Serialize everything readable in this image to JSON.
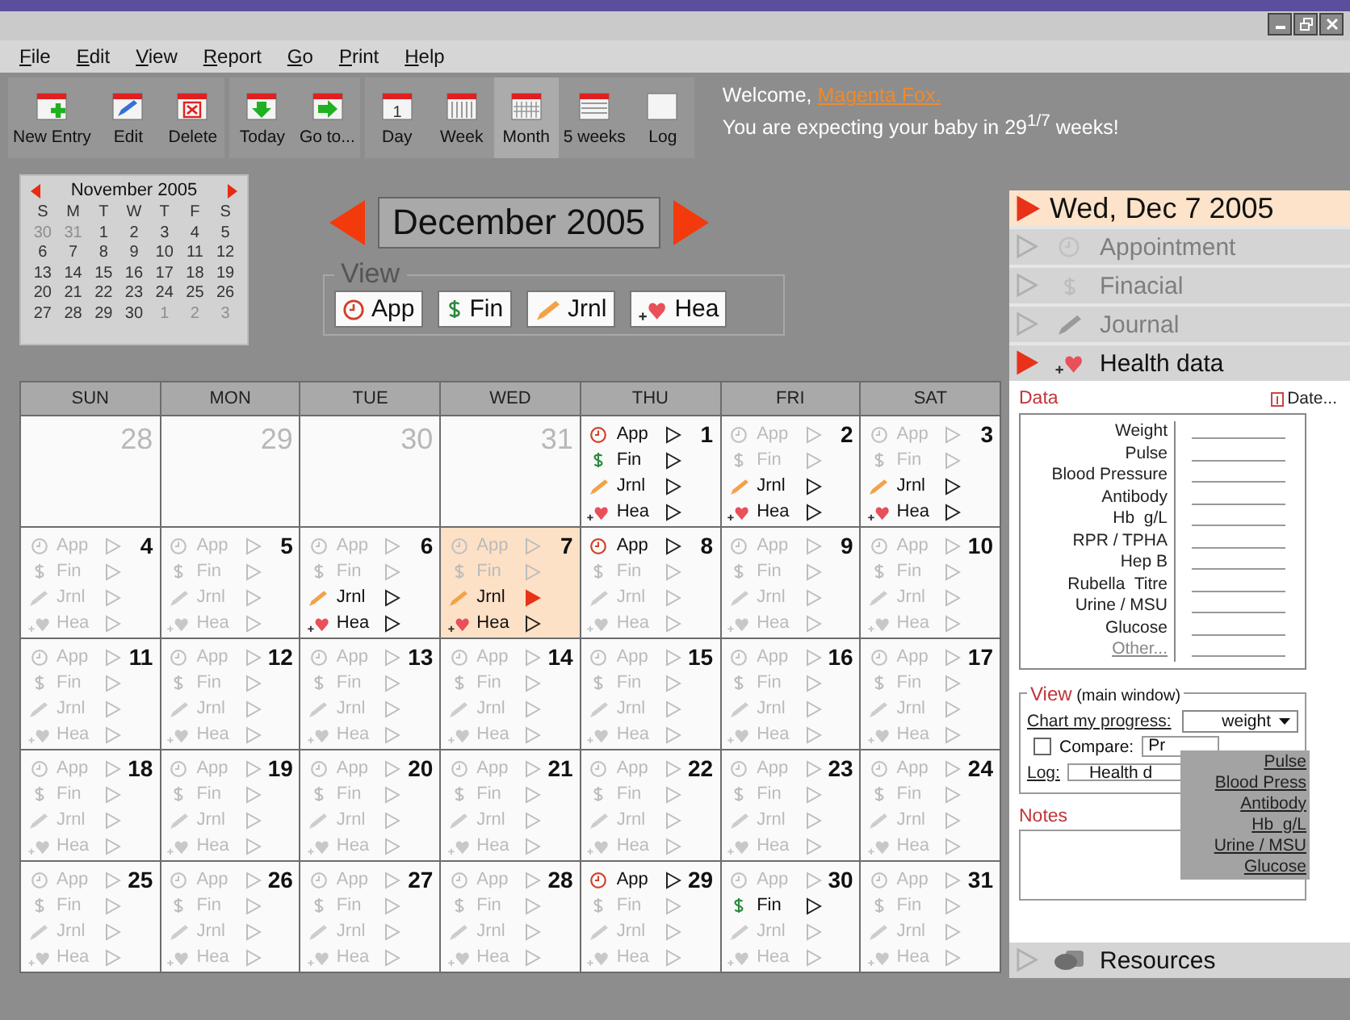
{
  "menu": [
    "File",
    "Edit",
    "View",
    "Report",
    "Go",
    "Print",
    "Help"
  ],
  "toolbar": {
    "groups": [
      [
        {
          "kind": "new",
          "label": "New Entry"
        },
        {
          "kind": "edit",
          "label": "Edit"
        },
        {
          "kind": "delete",
          "label": "Delete"
        }
      ],
      [
        {
          "kind": "today",
          "label": "Today"
        },
        {
          "kind": "goto",
          "label": "Go to..."
        }
      ],
      [
        {
          "kind": "day",
          "label": "Day",
          "icon_text": "1",
          "selected": false
        },
        {
          "kind": "week",
          "label": "Week",
          "selected": false
        },
        {
          "kind": "month",
          "label": "Month",
          "selected": true
        },
        {
          "kind": "weeks",
          "label": "5 weeks",
          "selected": false
        },
        {
          "kind": "log",
          "label": "Log",
          "selected": false
        }
      ]
    ]
  },
  "welcome": {
    "greeting": "Welcome,",
    "name": "Magenta Fox.",
    "message": "You are expecting your baby in 29$^{1/7}$ weeks!"
  },
  "mini_calendar": {
    "title": "November 2005",
    "weekdays": [
      "S",
      "M",
      "T",
      "W",
      "T",
      "F",
      "S"
    ],
    "days": [
      {
        "day": "30",
        "muted": true
      },
      {
        "day": "31",
        "muted": true
      },
      {
        "day": "1",
        "muted": false
      },
      {
        "day": "2",
        "muted": false
      },
      {
        "day": "3",
        "muted": false
      },
      {
        "day": "4",
        "muted": false
      },
      {
        "day": "5",
        "muted": false
      },
      {
        "day": "6",
        "muted": false
      },
      {
        "day": "7",
        "muted": false
      },
      {
        "day": "8",
        "muted": false
      },
      {
        "day": "9",
        "muted": false
      },
      {
        "day": "10",
        "muted": false
      },
      {
        "day": "11",
        "muted": false
      },
      {
        "day": "12",
        "muted": false
      },
      {
        "day": "13",
        "muted": false
      },
      {
        "day": "14",
        "muted": false
      },
      {
        "day": "15",
        "muted": false
      },
      {
        "day": "16",
        "muted": false
      },
      {
        "day": "17",
        "muted": false
      },
      {
        "day": "18",
        "muted": false
      },
      {
        "day": "19",
        "muted": false
      },
      {
        "day": "20",
        "muted": false
      },
      {
        "day": "21",
        "muted": false
      },
      {
        "day": "22",
        "muted": false
      },
      {
        "day": "23",
        "muted": false
      },
      {
        "day": "24",
        "muted": false
      },
      {
        "day": "25",
        "muted": false
      },
      {
        "day": "26",
        "muted": false
      },
      {
        "day": "27",
        "muted": false
      },
      {
        "day": "28",
        "muted": false
      },
      {
        "day": "29",
        "muted": false
      },
      {
        "day": "30",
        "muted": false
      },
      {
        "day": "1",
        "muted": true
      },
      {
        "day": "2",
        "muted": true
      },
      {
        "day": "3",
        "muted": true
      }
    ]
  },
  "month_nav": {
    "title": "December 2005"
  },
  "view_filter": {
    "title": "View",
    "buttons": [
      {
        "kind": "app",
        "label": "App"
      },
      {
        "kind": "fin",
        "label": "Fin"
      },
      {
        "kind": "jrnl",
        "label": "Jrnl"
      },
      {
        "kind": "hea",
        "label": "Hea"
      }
    ]
  },
  "calendar": {
    "columns": [
      "SUN",
      "MON",
      "TUE",
      "WED",
      "THU",
      "FRI",
      "SAT"
    ],
    "weeks": [
      [
        {
          "day": "28",
          "muted": true,
          "selected": false
        },
        {
          "day": "29",
          "muted": true,
          "selected": false
        },
        {
          "day": "30",
          "muted": true,
          "selected": false
        },
        {
          "day": "31",
          "muted": true,
          "selected": false
        },
        {
          "day": "1",
          "muted": false,
          "selected": false,
          "entries": [
            {
              "kind": "app",
              "label": "App",
              "active": true,
              "selected": false
            },
            {
              "kind": "fin",
              "label": "Fin",
              "active": true,
              "selected": false
            },
            {
              "kind": "jrnl",
              "label": "Jrnl",
              "active": true,
              "selected": false
            },
            {
              "kind": "hea",
              "label": "Hea",
              "active": true,
              "selected": false
            }
          ]
        },
        {
          "day": "2",
          "muted": false,
          "selected": false,
          "entries": [
            {
              "kind": "app",
              "label": "App",
              "active": false,
              "selected": false
            },
            {
              "kind": "fin",
              "label": "Fin",
              "active": false,
              "selected": false
            },
            {
              "kind": "jrnl",
              "label": "Jrnl",
              "active": true,
              "selected": false
            },
            {
              "kind": "hea",
              "label": "Hea",
              "active": true,
              "selected": false
            }
          ]
        },
        {
          "day": "3",
          "muted": false,
          "selected": false,
          "entries": [
            {
              "kind": "app",
              "label": "App",
              "active": false,
              "selected": false
            },
            {
              "kind": "fin",
              "label": "Fin",
              "active": false,
              "selected": false
            },
            {
              "kind": "jrnl",
              "label": "Jrnl",
              "active": true,
              "selected": false
            },
            {
              "kind": "hea",
              "label": "Hea",
              "active": true,
              "selected": false
            }
          ]
        }
      ],
      [
        {
          "day": "4",
          "muted": false,
          "selected": false,
          "entries": [
            {
              "kind": "app",
              "label": "App",
              "active": false,
              "selected": false
            },
            {
              "kind": "fin",
              "label": "Fin",
              "active": false,
              "selected": false
            },
            {
              "kind": "jrnl",
              "label": "Jrnl",
              "active": false,
              "selected": false
            },
            {
              "kind": "hea",
              "label": "Hea",
              "active": false,
              "selected": false
            }
          ]
        },
        {
          "day": "5",
          "muted": false,
          "selected": false,
          "entries": [
            {
              "kind": "app",
              "label": "App",
              "active": false,
              "selected": false
            },
            {
              "kind": "fin",
              "label": "Fin",
              "active": false,
              "selected": false
            },
            {
              "kind": "jrnl",
              "label": "Jrnl",
              "active": false,
              "selected": false
            },
            {
              "kind": "hea",
              "label": "Hea",
              "active": false,
              "selected": false
            }
          ]
        },
        {
          "day": "6",
          "muted": false,
          "selected": false,
          "entries": [
            {
              "kind": "app",
              "label": "App",
              "active": false,
              "selected": false
            },
            {
              "kind": "fin",
              "label": "Fin",
              "active": false,
              "selected": false
            },
            {
              "kind": "jrnl",
              "label": "Jrnl",
              "active": true,
              "selected": false
            },
            {
              "kind": "hea",
              "label": "Hea",
              "active": true,
              "selected": false
            }
          ]
        },
        {
          "day": "7",
          "muted": false,
          "selected": true,
          "entries": [
            {
              "kind": "app",
              "label": "App",
              "active": false,
              "selected": false
            },
            {
              "kind": "fin",
              "label": "Fin",
              "active": false,
              "selected": false
            },
            {
              "kind": "jrnl",
              "label": "Jrnl",
              "active": true,
              "selected": true
            },
            {
              "kind": "hea",
              "label": "Hea",
              "active": true,
              "selected": false
            }
          ]
        },
        {
          "day": "8",
          "muted": false,
          "selected": false,
          "entries": [
            {
              "kind": "app",
              "label": "App",
              "active": true,
              "selected": false
            },
            {
              "kind": "fin",
              "label": "Fin",
              "active": false,
              "selected": false
            },
            {
              "kind": "jrnl",
              "label": "Jrnl",
              "active": false,
              "selected": false
            },
            {
              "kind": "hea",
              "label": "Hea",
              "active": false,
              "selected": false
            }
          ]
        },
        {
          "day": "9",
          "muted": false,
          "selected": false,
          "entries": [
            {
              "kind": "app",
              "label": "App",
              "active": false,
              "selected": false
            },
            {
              "kind": "fin",
              "label": "Fin",
              "active": false,
              "selected": false
            },
            {
              "kind": "jrnl",
              "label": "Jrnl",
              "active": false,
              "selected": false
            },
            {
              "kind": "hea",
              "label": "Hea",
              "active": false,
              "selected": false
            }
          ]
        },
        {
          "day": "10",
          "muted": false,
          "selected": false,
          "entries": [
            {
              "kind": "app",
              "label": "App",
              "active": false,
              "selected": false
            },
            {
              "kind": "fin",
              "label": "Fin",
              "active": false,
              "selected": false
            },
            {
              "kind": "jrnl",
              "label": "Jrnl",
              "active": false,
              "selected": false
            },
            {
              "kind": "hea",
              "label": "Hea",
              "active": false,
              "selected": false
            }
          ]
        }
      ],
      [
        {
          "day": "11",
          "muted": false,
          "selected": false,
          "entries": [
            {
              "kind": "app",
              "label": "App",
              "active": false,
              "selected": false
            },
            {
              "kind": "fin",
              "label": "Fin",
              "active": false,
              "selected": false
            },
            {
              "kind": "jrnl",
              "label": "Jrnl",
              "active": false,
              "selected": false
            },
            {
              "kind": "hea",
              "label": "Hea",
              "active": false,
              "selected": false
            }
          ]
        },
        {
          "day": "12",
          "muted": false,
          "selected": false,
          "entries": [
            {
              "kind": "app",
              "label": "App",
              "active": false,
              "selected": false
            },
            {
              "kind": "fin",
              "label": "Fin",
              "active": false,
              "selected": false
            },
            {
              "kind": "jrnl",
              "label": "Jrnl",
              "active": false,
              "selected": false
            },
            {
              "kind": "hea",
              "label": "Hea",
              "active": false,
              "selected": false
            }
          ]
        },
        {
          "day": "13",
          "muted": false,
          "selected": false,
          "entries": [
            {
              "kind": "app",
              "label": "App",
              "active": false,
              "selected": false
            },
            {
              "kind": "fin",
              "label": "Fin",
              "active": false,
              "selected": false
            },
            {
              "kind": "jrnl",
              "label": "Jrnl",
              "active": false,
              "selected": false
            },
            {
              "kind": "hea",
              "label": "Hea",
              "active": false,
              "selected": false
            }
          ]
        },
        {
          "day": "14",
          "muted": false,
          "selected": false,
          "entries": [
            {
              "kind": "app",
              "label": "App",
              "active": false,
              "selected": false
            },
            {
              "kind": "fin",
              "label": "Fin",
              "active": false,
              "selected": false
            },
            {
              "kind": "jrnl",
              "label": "Jrnl",
              "active": false,
              "selected": false
            },
            {
              "kind": "hea",
              "label": "Hea",
              "active": false,
              "selected": false
            }
          ]
        },
        {
          "day": "15",
          "muted": false,
          "selected": false,
          "entries": [
            {
              "kind": "app",
              "label": "App",
              "active": false,
              "selected": false
            },
            {
              "kind": "fin",
              "label": "Fin",
              "active": false,
              "selected": false
            },
            {
              "kind": "jrnl",
              "label": "Jrnl",
              "active": false,
              "selected": false
            },
            {
              "kind": "hea",
              "label": "Hea",
              "active": false,
              "selected": false
            }
          ]
        },
        {
          "day": "16",
          "muted": false,
          "selected": false,
          "entries": [
            {
              "kind": "app",
              "label": "App",
              "active": false,
              "selected": false
            },
            {
              "kind": "fin",
              "label": "Fin",
              "active": false,
              "selected": false
            },
            {
              "kind": "jrnl",
              "label": "Jrnl",
              "active": false,
              "selected": false
            },
            {
              "kind": "hea",
              "label": "Hea",
              "active": false,
              "selected": false
            }
          ]
        },
        {
          "day": "17",
          "muted": false,
          "selected": false,
          "entries": [
            {
              "kind": "app",
              "label": "App",
              "active": false,
              "selected": false
            },
            {
              "kind": "fin",
              "label": "Fin",
              "active": false,
              "selected": false
            },
            {
              "kind": "jrnl",
              "label": "Jrnl",
              "active": false,
              "selected": false
            },
            {
              "kind": "hea",
              "label": "Hea",
              "active": false,
              "selected": false
            }
          ]
        }
      ],
      [
        {
          "day": "18",
          "muted": false,
          "selected": false,
          "entries": [
            {
              "kind": "app",
              "label": "App",
              "active": false,
              "selected": false
            },
            {
              "kind": "fin",
              "label": "Fin",
              "active": false,
              "selected": false
            },
            {
              "kind": "jrnl",
              "label": "Jrnl",
              "active": false,
              "selected": false
            },
            {
              "kind": "hea",
              "label": "Hea",
              "active": false,
              "selected": false
            }
          ]
        },
        {
          "day": "19",
          "muted": false,
          "selected": false,
          "entries": [
            {
              "kind": "app",
              "label": "App",
              "active": false,
              "selected": false
            },
            {
              "kind": "fin",
              "label": "Fin",
              "active": false,
              "selected": false
            },
            {
              "kind": "jrnl",
              "label": "Jrnl",
              "active": false,
              "selected": false
            },
            {
              "kind": "hea",
              "label": "Hea",
              "active": false,
              "selected": false
            }
          ]
        },
        {
          "day": "20",
          "muted": false,
          "selected": false,
          "entries": [
            {
              "kind": "app",
              "label": "App",
              "active": false,
              "selected": false
            },
            {
              "kind": "fin",
              "label": "Fin",
              "active": false,
              "selected": false
            },
            {
              "kind": "jrnl",
              "label": "Jrnl",
              "active": false,
              "selected": false
            },
            {
              "kind": "hea",
              "label": "Hea",
              "active": false,
              "selected": false
            }
          ]
        },
        {
          "day": "21",
          "muted": false,
          "selected": false,
          "entries": [
            {
              "kind": "app",
              "label": "App",
              "active": false,
              "selected": false
            },
            {
              "kind": "fin",
              "label": "Fin",
              "active": false,
              "selected": false
            },
            {
              "kind": "jrnl",
              "label": "Jrnl",
              "active": false,
              "selected": false
            },
            {
              "kind": "hea",
              "label": "Hea",
              "active": false,
              "selected": false
            }
          ]
        },
        {
          "day": "22",
          "muted": false,
          "selected": false,
          "entries": [
            {
              "kind": "app",
              "label": "App",
              "active": false,
              "selected": false
            },
            {
              "kind": "fin",
              "label": "Fin",
              "active": false,
              "selected": false
            },
            {
              "kind": "jrnl",
              "label": "Jrnl",
              "active": false,
              "selected": false
            },
            {
              "kind": "hea",
              "label": "Hea",
              "active": false,
              "selected": false
            }
          ]
        },
        {
          "day": "23",
          "muted": false,
          "selected": false,
          "entries": [
            {
              "kind": "app",
              "label": "App",
              "active": false,
              "selected": false
            },
            {
              "kind": "fin",
              "label": "Fin",
              "active": false,
              "selected": false
            },
            {
              "kind": "jrnl",
              "label": "Jrnl",
              "active": false,
              "selected": false
            },
            {
              "kind": "hea",
              "label": "Hea",
              "active": false,
              "selected": false
            }
          ]
        },
        {
          "day": "24",
          "muted": false,
          "selected": false,
          "entries": [
            {
              "kind": "app",
              "label": "App",
              "active": false,
              "selected": false
            },
            {
              "kind": "fin",
              "label": "Fin",
              "active": false,
              "selected": false
            },
            {
              "kind": "jrnl",
              "label": "Jrnl",
              "active": false,
              "selected": false
            },
            {
              "kind": "hea",
              "label": "Hea",
              "active": false,
              "selected": false
            }
          ]
        }
      ],
      [
        {
          "day": "25",
          "muted": false,
          "selected": false,
          "entries": [
            {
              "kind": "app",
              "label": "App",
              "active": false,
              "selected": false
            },
            {
              "kind": "fin",
              "label": "Fin",
              "active": false,
              "selected": false
            },
            {
              "kind": "jrnl",
              "label": "Jrnl",
              "active": false,
              "selected": false
            },
            {
              "kind": "hea",
              "label": "Hea",
              "active": false,
              "selected": false
            }
          ]
        },
        {
          "day": "26",
          "muted": false,
          "selected": false,
          "entries": [
            {
              "kind": "app",
              "label": "App",
              "active": false,
              "selected": false
            },
            {
              "kind": "fin",
              "label": "Fin",
              "active": false,
              "selected": false
            },
            {
              "kind": "jrnl",
              "label": "Jrnl",
              "active": false,
              "selected": false
            },
            {
              "kind": "hea",
              "label": "Hea",
              "active": false,
              "selected": false
            }
          ]
        },
        {
          "day": "27",
          "muted": false,
          "selected": false,
          "entries": [
            {
              "kind": "app",
              "label": "App",
              "active": false,
              "selected": false
            },
            {
              "kind": "fin",
              "label": "Fin",
              "active": false,
              "selected": false
            },
            {
              "kind": "jrnl",
              "label": "Jrnl",
              "active": false,
              "selected": false
            },
            {
              "kind": "hea",
              "label": "Hea",
              "active": false,
              "selected": false
            }
          ]
        },
        {
          "day": "28",
          "muted": false,
          "selected": false,
          "entries": [
            {
              "kind": "app",
              "label": "App",
              "active": false,
              "selected": false
            },
            {
              "kind": "fin",
              "label": "Fin",
              "active": false,
              "selected": false
            },
            {
              "kind": "jrnl",
              "label": "Jrnl",
              "active": false,
              "selected": false
            },
            {
              "kind": "hea",
              "label": "Hea",
              "active": false,
              "selected": false
            }
          ]
        },
        {
          "day": "29",
          "muted": false,
          "selected": false,
          "entries": [
            {
              "kind": "app",
              "label": "App",
              "active": true,
              "selected": false
            },
            {
              "kind": "fin",
              "label": "Fin",
              "active": false,
              "selected": false
            },
            {
              "kind": "jrnl",
              "label": "Jrnl",
              "active": false,
              "selected": false
            },
            {
              "kind": "hea",
              "label": "Hea",
              "active": false,
              "selected": false
            }
          ]
        },
        {
          "day": "30",
          "muted": false,
          "selected": false,
          "entries": [
            {
              "kind": "app",
              "label": "App",
              "active": false,
              "selected": false
            },
            {
              "kind": "fin",
              "label": "Fin",
              "active": true,
              "selected": false
            },
            {
              "kind": "jrnl",
              "label": "Jrnl",
              "active": false,
              "selected": false
            },
            {
              "kind": "hea",
              "label": "Hea",
              "active": false,
              "selected": false
            }
          ]
        },
        {
          "day": "31",
          "muted": false,
          "selected": false,
          "entries": [
            {
              "kind": "app",
              "label": "App",
              "active": false,
              "selected": false
            },
            {
              "kind": "fin",
              "label": "Fin",
              "active": false,
              "selected": false
            },
            {
              "kind": "jrnl",
              "label": "Jrnl",
              "active": false,
              "selected": false
            },
            {
              "kind": "hea",
              "label": "Hea",
              "active": false,
              "selected": false
            }
          ]
        }
      ]
    ]
  },
  "day_panel": {
    "date": "Wed, Dec 7 2005",
    "sections": [
      {
        "kind": "app",
        "label": "Appointment",
        "expanded": false
      },
      {
        "kind": "fin",
        "label": "Finacial",
        "expanded": false
      },
      {
        "kind": "jrnl",
        "label": "Journal",
        "expanded": false
      },
      {
        "kind": "hea",
        "label": "Health data",
        "expanded": true
      }
    ],
    "data_title": "Data",
    "date_link": "Date...",
    "fields": [
      "Weight",
      "Pulse",
      "Blood Pressure",
      "Antibody",
      "Hb  g/L",
      "RPR / TPHA",
      "Hep B",
      "Rubella  Titre",
      "Urine / MSU",
      "Glucose"
    ],
    "other_link": "Other...",
    "view": {
      "title": "View",
      "subtitle": "(main window)",
      "chart_label": "Chart my progress:",
      "chart_value": "weight",
      "options": [
        "Pulse",
        "Blood Press",
        "Antibody",
        "Hb  g/L",
        "Urine / MSU",
        "Glucose"
      ],
      "compare_label": "Compare:",
      "compare_checked": false,
      "compare_value": "Pr",
      "log_label": "Log:",
      "log_value": "Health d"
    },
    "notes_title": "Notes",
    "resources": {
      "kind": "resources",
      "label": "Resources",
      "expanded": false
    }
  }
}
